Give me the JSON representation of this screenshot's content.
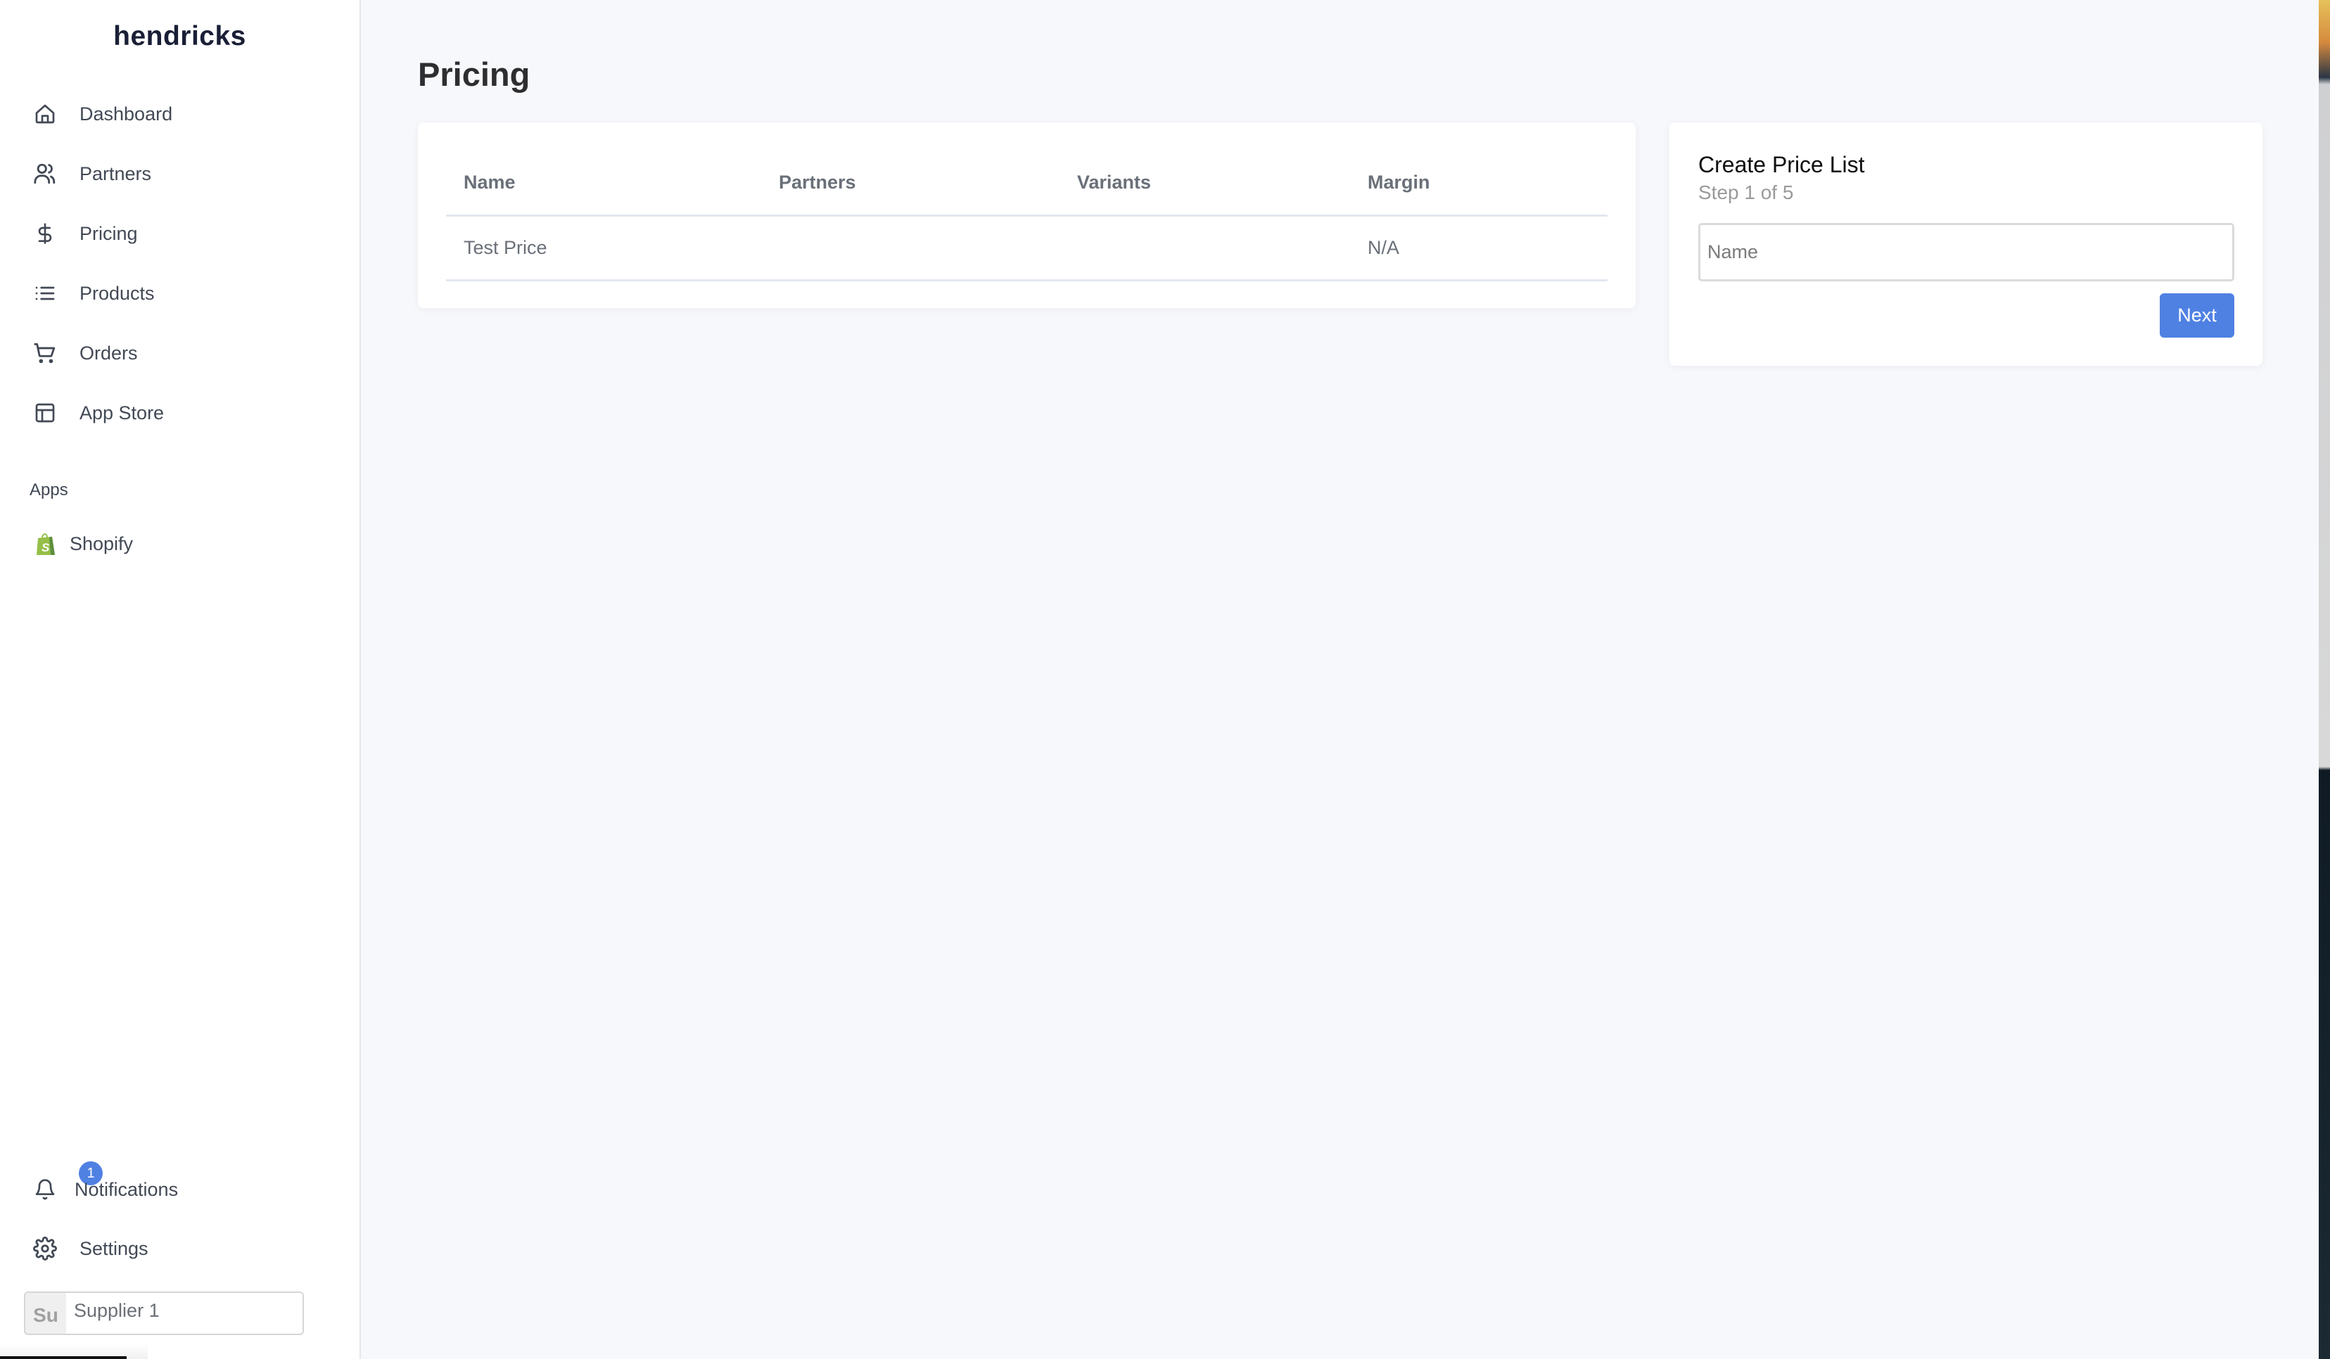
{
  "sidebar": {
    "brand": "hendricks",
    "nav": [
      {
        "label": "Dashboard",
        "icon": "home-icon"
      },
      {
        "label": "Partners",
        "icon": "users-icon"
      },
      {
        "label": "Pricing",
        "icon": "dollar-icon"
      },
      {
        "label": "Products",
        "icon": "list-icon"
      },
      {
        "label": "Orders",
        "icon": "cart-icon"
      },
      {
        "label": "App Store",
        "icon": "layout-icon"
      }
    ],
    "apps_heading": "Apps",
    "apps": [
      {
        "label": "Shopify",
        "icon": "shopify-bag-icon",
        "color": "#95bf47"
      }
    ],
    "notifications": {
      "label": "Notifications",
      "badge_count": "1",
      "icon": "bell-icon"
    },
    "settings": {
      "label": "Settings",
      "icon": "gear-icon"
    },
    "account": {
      "initials": "Su",
      "name": "Supplier 1"
    }
  },
  "main": {
    "title": "Pricing",
    "table": {
      "columns": [
        "Name",
        "Partners",
        "Variants",
        "Margin"
      ],
      "rows": [
        {
          "name": "Test Price",
          "partners": "",
          "variants": "",
          "margin": "N/A"
        }
      ]
    },
    "create_card": {
      "title": "Create Price List",
      "step": "Step 1 of 5",
      "name_placeholder": "Name",
      "name_value": "",
      "next_label": "Next"
    }
  },
  "colors": {
    "accent": "#4f81e3",
    "background": "#f7f8fb",
    "sidebar_text": "#424955"
  }
}
